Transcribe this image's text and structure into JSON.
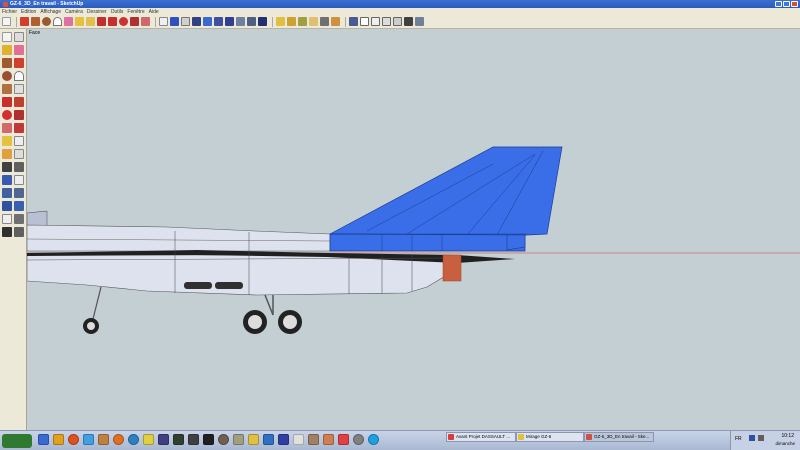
{
  "window": {
    "title": "GZ-6_3D_En travail - SketchUp"
  },
  "menubar": {
    "items": [
      "Fichier",
      "Edition",
      "Affichage",
      "Caméra",
      "Dessiner",
      "Outils",
      "Fenêtre",
      "Aide"
    ]
  },
  "toolbar": {
    "icons": [
      "select-icon",
      "pencil-icon",
      "rectangle-icon",
      "circle-icon",
      "arc-icon",
      "eraser-icon",
      "tape-icon",
      "paint-bucket-icon",
      "push-pull-icon",
      "move-icon",
      "rotate-icon",
      "follow-me-icon",
      "scale-icon",
      "offset-icon",
      "dimension-icon",
      "protractor-icon",
      "text-icon",
      "axes-icon",
      "orbit-icon",
      "pan-icon",
      "zoom-icon",
      "zoom-window-icon",
      "zoom-extents-icon",
      "previous-view-icon",
      "next-view-icon",
      "walk-icon",
      "look-around-icon",
      "position-camera-icon",
      "section-plane-icon",
      "iso-view-icon",
      "top-view-icon",
      "front-view-icon",
      "right-view-icon",
      "back-view-icon",
      "left-view-icon",
      "xray-icon",
      "wireframe-icon",
      "hidden-line-icon",
      "shaded-icon",
      "textured-icon",
      "monochrome-icon"
    ]
  },
  "viewport": {
    "view_name": "Face"
  },
  "colors": {
    "sky": "#c3cfd3",
    "fuselage": "#dde2ee",
    "fin": "#3a6ee8",
    "horizon": "#d04040"
  },
  "taskbar": {
    "tasks": [
      {
        "label": "Avant Projet DASSAULT ..."
      },
      {
        "label": "Mirage GZ-6"
      },
      {
        "label": "GZ-6_3D_En travail - Ske..."
      }
    ],
    "language": "FR",
    "time": "10:12",
    "day": "dimanche"
  }
}
